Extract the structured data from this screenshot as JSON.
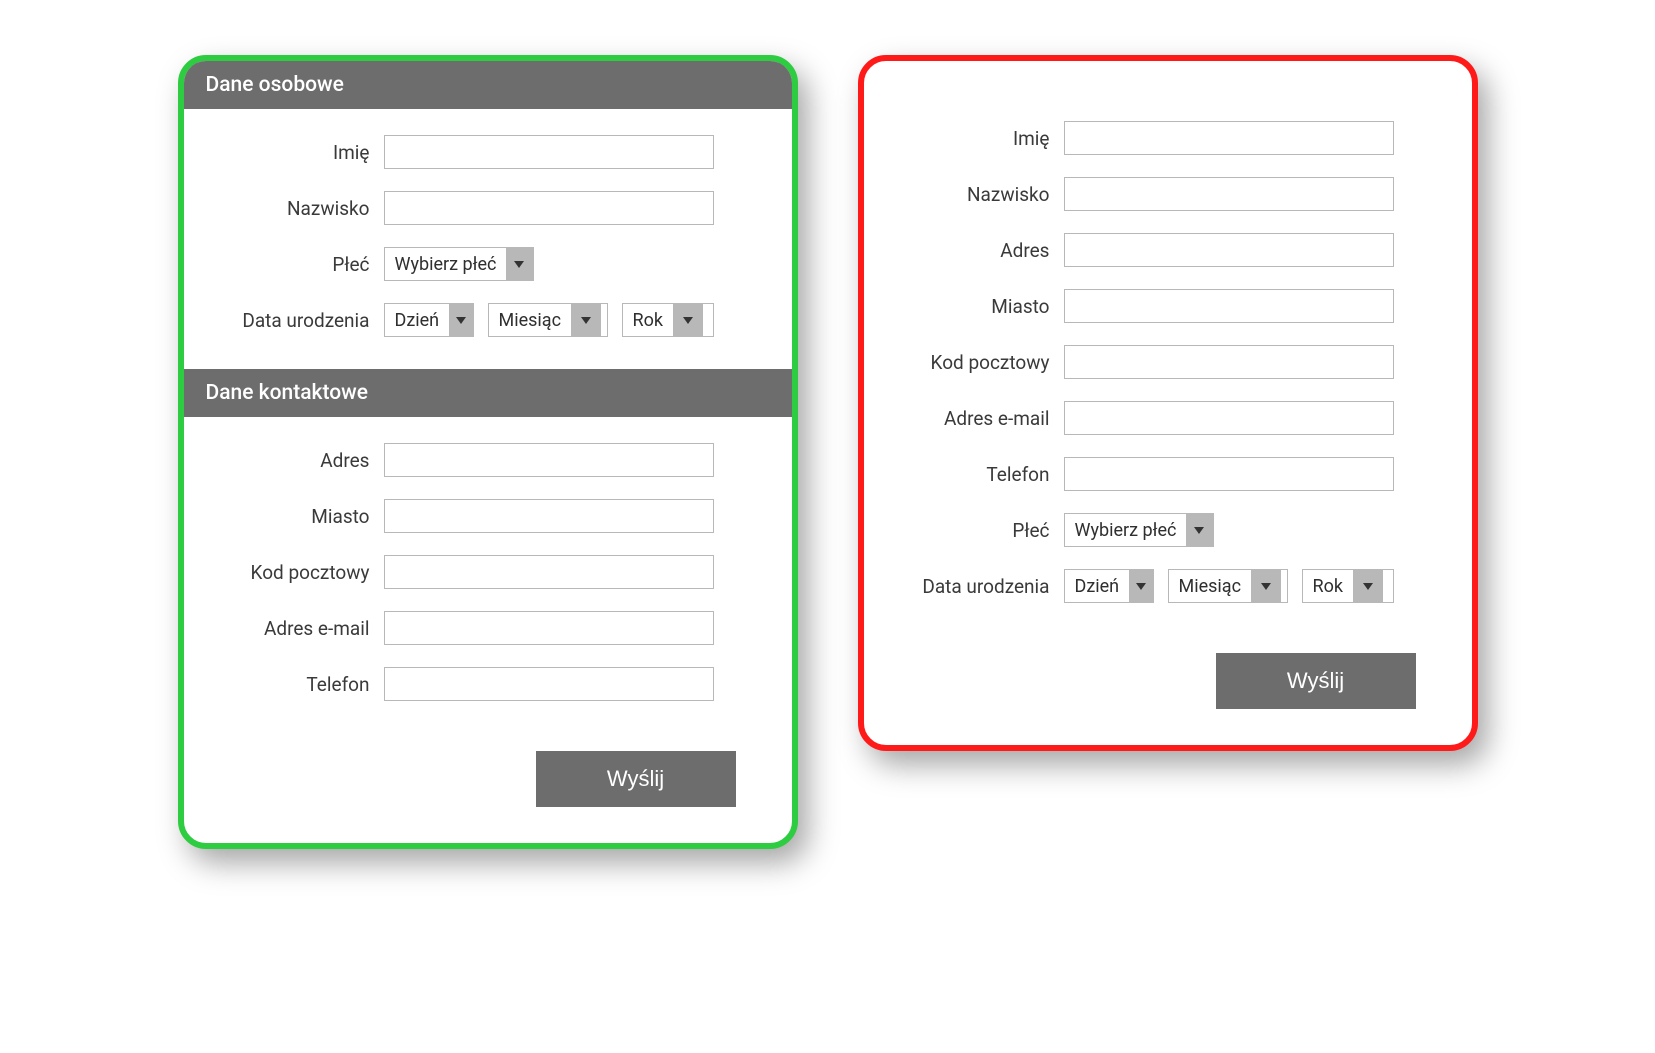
{
  "left": {
    "section1_title": "Dane osobowe",
    "section2_title": "Dane kontaktowe",
    "labels": {
      "firstname": "Imię",
      "lastname": "Nazwisko",
      "gender": "Płeć",
      "dob": "Data urodzenia",
      "address": "Adres",
      "city": "Miasto",
      "postcode": "Kod pocztowy",
      "email": "Adres e-mail",
      "phone": "Telefon"
    },
    "selects": {
      "gender_placeholder": "Wybierz płeć",
      "day": "Dzień",
      "month": "Miesiąc",
      "year": "Rok"
    },
    "submit": "Wyślij"
  },
  "right": {
    "labels": {
      "firstname": "Imię",
      "lastname": "Nazwisko",
      "address": "Adres",
      "city": "Miasto",
      "postcode": "Kod pocztowy",
      "email": "Adres e-mail",
      "phone": "Telefon",
      "gender": "Płeć",
      "dob": "Data urodzenia"
    },
    "selects": {
      "gender_placeholder": "Wybierz płeć",
      "day": "Dzień",
      "month": "Miesiąc",
      "year": "Rok"
    },
    "submit": "Wyślij"
  }
}
